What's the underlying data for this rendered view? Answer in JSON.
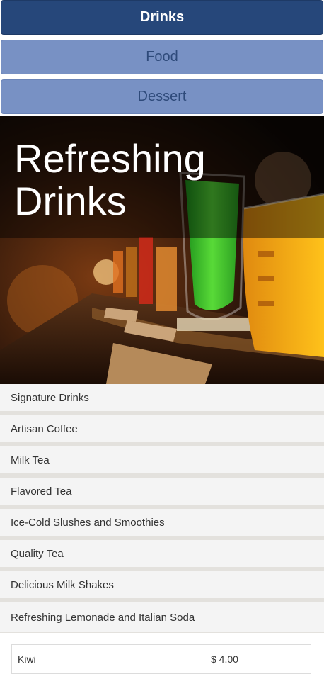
{
  "tabs": [
    {
      "label": "Drinks",
      "active": true
    },
    {
      "label": "Food",
      "active": false
    },
    {
      "label": "Dessert",
      "active": false
    }
  ],
  "hero": {
    "title": "Refreshing Drinks"
  },
  "categories": [
    {
      "label": "Signature Drinks"
    },
    {
      "label": "Artisan Coffee"
    },
    {
      "label": "Milk Tea"
    },
    {
      "label": "Flavored Tea"
    },
    {
      "label": "Ice-Cold Slushes and Smoothies"
    },
    {
      "label": "Quality Tea"
    },
    {
      "label": "Delicious Milk Shakes"
    },
    {
      "label": "Refreshing Lemonade and Italian Soda",
      "open": true
    }
  ],
  "menu_items": [
    {
      "name": "Kiwi",
      "price": "$ 4.00"
    }
  ],
  "colors": {
    "active_tab": "#26477a",
    "inactive_tab": "#7891c4",
    "inactive_tab_text": "#2e4a7a",
    "category_bg": "#f4f4f4"
  }
}
